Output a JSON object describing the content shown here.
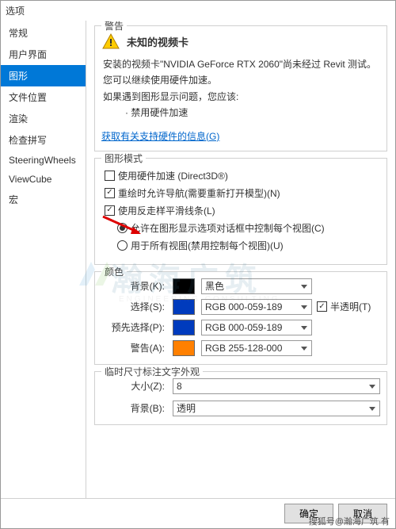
{
  "title": "选项",
  "sidebar": {
    "items": [
      {
        "label": "常规"
      },
      {
        "label": "用户界面"
      },
      {
        "label": "图形"
      },
      {
        "label": "文件位置"
      },
      {
        "label": "渲染"
      },
      {
        "label": "检查拼写"
      },
      {
        "label": "SteeringWheels"
      },
      {
        "label": "ViewCube"
      },
      {
        "label": "宏"
      }
    ],
    "selected_index": 2
  },
  "warning": {
    "group": "警告",
    "head": "未知的视频卡",
    "line1": "安装的视频卡\"NVIDIA GeForce RTX 2060\"尚未经过 Revit 测试。",
    "line2": "您可以继续使用硬件加速。",
    "line3": "如果遇到图形显示问题，您应该:",
    "bullet": "· 禁用硬件加速",
    "link": "获取有关支持硬件的信息(G)"
  },
  "graphics": {
    "group": "图形模式",
    "hwaccel": "使用硬件加速 (Direct3D®)",
    "redraw": "重绘时允许导航(需要重新打开模型)(N)",
    "antialias": "使用反走样平滑线条(L)",
    "radio1": "允许在图形显示选项对话框中控制每个视图(C)",
    "radio2": "用于所有视图(禁用控制每个视图)(U)"
  },
  "colors": {
    "group": "颜色",
    "bg_label": "背景(K):",
    "bg_val": "黑色",
    "bg_hex": "#000000",
    "sel_label": "选择(S):",
    "sel_val": "RGB 000-059-189",
    "sel_hex": "#003bbd",
    "presel_label": "预先选择(P):",
    "presel_val": "RGB 000-059-189",
    "presel_hex": "#003bbd",
    "warn_label": "警告(A):",
    "warn_val": "RGB 255-128-000",
    "warn_hex": "#ff8000",
    "semi": "半透明(T)"
  },
  "temp": {
    "group": "临时尺寸标注文字外观",
    "size_label": "大小(Z):",
    "size_val": "8",
    "bg_label": "背景(B):",
    "bg_val": "透明"
  },
  "buttons": {
    "ok": "确定",
    "cancel": "取消"
  },
  "credit": "搜狐号@瀚海广筑 有",
  "watermark": "瀚海广筑",
  "watermark_sub": "ENGINEERING CONSULTING"
}
